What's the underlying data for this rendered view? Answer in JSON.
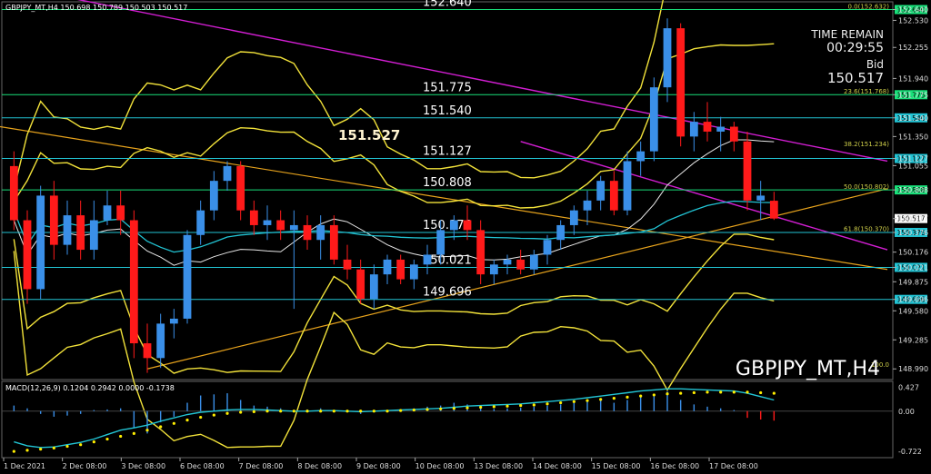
{
  "header": {
    "title": "GBPJPY_MT,H4  150.698 150.789 150.503 150.517"
  },
  "info": {
    "time_remain_label": "TIME REMAIN",
    "time_remain_value": "00:29:55",
    "bid_label": "Bid",
    "bid_value": "150.517",
    "highlight_price": "151.527",
    "symbol_watermark": "GBPJPY_MT,H4"
  },
  "colors": {
    "background": "#000000",
    "bull": "#3a8fe8",
    "bear": "#ff1a1a",
    "level_line": "#19e07a",
    "cyan_line": "#22c4d4",
    "bollinger": "#f2e23a",
    "magenta": "#d21ed2",
    "orange": "#e6a21c",
    "macd_hist": "#3a8fe8",
    "macd_signal": "#ffee00",
    "macd_line": "#22c4d4",
    "price_tag": "#1b5fd6"
  },
  "chart_data": {
    "type": "candlestick",
    "symbol": "GBPJPY_MT",
    "timeframe": "H4",
    "ylim": [
      148.9,
      152.7
    ],
    "y_ticks": [
      "152.640",
      "152.530",
      "152.255",
      "151.940",
      "151.775",
      "151.540",
      "151.350",
      "151.127",
      "151.055",
      "150.808",
      "150.517",
      "150.376",
      "150.176",
      "150.021",
      "149.875",
      "149.696",
      "149.580",
      "149.285",
      "148.990"
    ],
    "x_ticks": [
      "1 Dec 2021",
      "2 Dec 08:00",
      "3 Dec 08:00",
      "6 Dec 08:00",
      "7 Dec 08:00",
      "8 Dec 08:00",
      "9 Dec 08:00",
      "10 Dec 08:00",
      "13 Dec 08:00",
      "14 Dec 08:00",
      "15 Dec 08:00",
      "16 Dec 08:00",
      "17 Dec 08:00"
    ],
    "levels": [
      {
        "price": 152.64,
        "label": "152.640",
        "color": "green"
      },
      {
        "price": 151.775,
        "label": "151.775",
        "color": "green"
      },
      {
        "price": 151.54,
        "label": "151.540",
        "color": "cyan"
      },
      {
        "price": 151.127,
        "label": "151.127",
        "color": "cyan"
      },
      {
        "price": 150.808,
        "label": "150.808",
        "color": "green"
      },
      {
        "price": 150.376,
        "label": "150.376",
        "color": "cyan"
      },
      {
        "price": 150.021,
        "label": "150.021",
        "color": "cyan"
      },
      {
        "price": 149.696,
        "label": "149.696",
        "color": "cyan"
      }
    ],
    "fib_labels": [
      {
        "price": 152.632,
        "text": "0.0(152.632)"
      },
      {
        "price": 151.768,
        "text": "23.6(151.768)"
      },
      {
        "price": 151.234,
        "text": "38.2(151.234)"
      },
      {
        "price": 150.802,
        "text": "50.0(150.802)"
      },
      {
        "price": 150.37,
        "text": "61.8(150.370)"
      },
      {
        "price": 148.99,
        "text": "100.0"
      }
    ],
    "current_price": {
      "price": 150.517,
      "label": "150.517"
    },
    "candles": [
      {
        "o": 151.05,
        "h": 151.2,
        "l": 150.4,
        "c": 150.5
      },
      {
        "o": 150.5,
        "h": 150.6,
        "l": 149.65,
        "c": 149.8
      },
      {
        "o": 149.8,
        "h": 150.85,
        "l": 149.7,
        "c": 150.75
      },
      {
        "o": 150.75,
        "h": 150.9,
        "l": 150.1,
        "c": 150.25
      },
      {
        "o": 150.25,
        "h": 150.7,
        "l": 150.15,
        "c": 150.55
      },
      {
        "o": 150.55,
        "h": 150.7,
        "l": 150.1,
        "c": 150.2
      },
      {
        "o": 150.2,
        "h": 150.7,
        "l": 150.1,
        "c": 150.5
      },
      {
        "o": 150.5,
        "h": 150.8,
        "l": 150.45,
        "c": 150.65
      },
      {
        "o": 150.65,
        "h": 150.8,
        "l": 150.35,
        "c": 150.5
      },
      {
        "o": 150.5,
        "h": 150.6,
        "l": 149.1,
        "c": 149.25
      },
      {
        "o": 149.25,
        "h": 149.45,
        "l": 148.95,
        "c": 149.1
      },
      {
        "o": 149.1,
        "h": 149.55,
        "l": 149.0,
        "c": 149.45
      },
      {
        "o": 149.45,
        "h": 149.6,
        "l": 149.3,
        "c": 149.5
      },
      {
        "o": 149.5,
        "h": 150.4,
        "l": 149.45,
        "c": 150.35
      },
      {
        "o": 150.35,
        "h": 150.7,
        "l": 150.25,
        "c": 150.6
      },
      {
        "o": 150.6,
        "h": 151.0,
        "l": 150.5,
        "c": 150.9
      },
      {
        "o": 150.9,
        "h": 151.1,
        "l": 150.8,
        "c": 151.05
      },
      {
        "o": 151.05,
        "h": 151.1,
        "l": 150.5,
        "c": 150.6
      },
      {
        "o": 150.6,
        "h": 150.7,
        "l": 150.35,
        "c": 150.45
      },
      {
        "o": 150.45,
        "h": 150.65,
        "l": 150.3,
        "c": 150.5
      },
      {
        "o": 150.5,
        "h": 150.6,
        "l": 150.3,
        "c": 150.4
      },
      {
        "o": 150.4,
        "h": 150.6,
        "l": 149.6,
        "c": 150.45
      },
      {
        "o": 150.45,
        "h": 150.55,
        "l": 150.2,
        "c": 150.3
      },
      {
        "o": 150.3,
        "h": 150.55,
        "l": 150.1,
        "c": 150.45
      },
      {
        "o": 150.45,
        "h": 150.55,
        "l": 150.05,
        "c": 150.1
      },
      {
        "o": 150.1,
        "h": 150.25,
        "l": 149.9,
        "c": 150.0
      },
      {
        "o": 150.0,
        "h": 150.1,
        "l": 149.65,
        "c": 149.7
      },
      {
        "o": 149.7,
        "h": 150.05,
        "l": 149.6,
        "c": 149.95
      },
      {
        "o": 149.95,
        "h": 150.15,
        "l": 149.85,
        "c": 150.1
      },
      {
        "o": 150.1,
        "h": 150.15,
        "l": 149.85,
        "c": 149.9
      },
      {
        "o": 149.9,
        "h": 150.1,
        "l": 149.8,
        "c": 150.05
      },
      {
        "o": 150.05,
        "h": 150.25,
        "l": 149.95,
        "c": 150.15
      },
      {
        "o": 150.15,
        "h": 150.5,
        "l": 150.05,
        "c": 150.4
      },
      {
        "o": 150.4,
        "h": 150.55,
        "l": 150.3,
        "c": 150.5
      },
      {
        "o": 150.5,
        "h": 150.65,
        "l": 150.3,
        "c": 150.4
      },
      {
        "o": 150.4,
        "h": 150.5,
        "l": 149.85,
        "c": 149.95
      },
      {
        "o": 149.95,
        "h": 150.1,
        "l": 149.85,
        "c": 150.05
      },
      {
        "o": 150.05,
        "h": 150.15,
        "l": 149.95,
        "c": 150.1
      },
      {
        "o": 150.1,
        "h": 150.2,
        "l": 149.95,
        "c": 150.0
      },
      {
        "o": 150.0,
        "h": 150.2,
        "l": 149.95,
        "c": 150.15
      },
      {
        "o": 150.15,
        "h": 150.35,
        "l": 150.05,
        "c": 150.3
      },
      {
        "o": 150.3,
        "h": 150.5,
        "l": 150.2,
        "c": 150.45
      },
      {
        "o": 150.45,
        "h": 150.65,
        "l": 150.35,
        "c": 150.6
      },
      {
        "o": 150.6,
        "h": 150.8,
        "l": 150.45,
        "c": 150.7
      },
      {
        "o": 150.7,
        "h": 150.95,
        "l": 150.6,
        "c": 150.9
      },
      {
        "o": 150.9,
        "h": 151.0,
        "l": 150.55,
        "c": 150.6
      },
      {
        "o": 150.6,
        "h": 151.2,
        "l": 150.55,
        "c": 151.1
      },
      {
        "o": 151.1,
        "h": 151.3,
        "l": 150.95,
        "c": 151.2
      },
      {
        "o": 151.2,
        "h": 151.95,
        "l": 151.1,
        "c": 151.85
      },
      {
        "o": 151.85,
        "h": 152.55,
        "l": 151.7,
        "c": 152.45
      },
      {
        "o": 152.45,
        "h": 152.5,
        "l": 151.25,
        "c": 151.35
      },
      {
        "o": 151.35,
        "h": 151.6,
        "l": 151.2,
        "c": 151.5
      },
      {
        "o": 151.5,
        "h": 151.7,
        "l": 151.3,
        "c": 151.4
      },
      {
        "o": 151.4,
        "h": 151.55,
        "l": 151.2,
        "c": 151.45
      },
      {
        "o": 151.45,
        "h": 151.5,
        "l": 151.2,
        "c": 151.3
      },
      {
        "o": 151.3,
        "h": 151.4,
        "l": 150.6,
        "c": 150.7
      },
      {
        "o": 150.7,
        "h": 150.9,
        "l": 150.5,
        "c": 150.75
      },
      {
        "o": 150.698,
        "h": 150.789,
        "l": 150.503,
        "c": 150.517
      }
    ],
    "macd": {
      "label": "MACD(12,26,9) 0.1204 0.2942 0.0000 -0.1738",
      "ylim": [
        -0.8,
        0.5
      ],
      "y_ticks": [
        "0.427",
        "0.00",
        "-0.722"
      ],
      "histogram": [
        0.1,
        0.05,
        -0.05,
        -0.1,
        -0.08,
        -0.05,
        0.02,
        0.03,
        0.05,
        -0.3,
        -0.4,
        -0.2,
        -0.1,
        0.15,
        0.28,
        0.3,
        0.32,
        0.2,
        0.1,
        0.08,
        0.05,
        0.0,
        0.03,
        0.05,
        0.02,
        -0.02,
        -0.05,
        0.0,
        0.02,
        0.03,
        0.05,
        0.08,
        0.1,
        0.15,
        0.12,
        0.05,
        0.04,
        0.05,
        0.06,
        0.08,
        0.1,
        0.12,
        0.15,
        0.18,
        0.2,
        0.15,
        0.2,
        0.25,
        0.3,
        0.35,
        0.2,
        0.12,
        0.08,
        0.05,
        0.02,
        -0.12,
        -0.15,
        -0.17
      ],
      "macd_line": [
        -0.55,
        -0.62,
        -0.65,
        -0.64,
        -0.6,
        -0.56,
        -0.5,
        -0.42,
        -0.34,
        -0.3,
        -0.25,
        -0.18,
        -0.12,
        -0.06,
        -0.02,
        0.0,
        0.02,
        0.03,
        0.03,
        0.02,
        0.01,
        0.0,
        0.0,
        0.01,
        0.01,
        0.0,
        -0.01,
        0.0,
        0.01,
        0.02,
        0.03,
        0.04,
        0.05,
        0.07,
        0.09,
        0.1,
        0.11,
        0.12,
        0.13,
        0.15,
        0.17,
        0.19,
        0.21,
        0.24,
        0.27,
        0.3,
        0.33,
        0.36,
        0.38,
        0.4,
        0.4,
        0.39,
        0.38,
        0.37,
        0.36,
        0.32,
        0.26,
        0.2
      ],
      "signal_line": [
        -0.72,
        -0.7,
        -0.68,
        -0.66,
        -0.63,
        -0.6,
        -0.55,
        -0.5,
        -0.45,
        -0.4,
        -0.34,
        -0.28,
        -0.22,
        -0.16,
        -0.11,
        -0.07,
        -0.04,
        -0.02,
        -0.01,
        0.0,
        0.0,
        0.0,
        0.0,
        0.0,
        0.0,
        0.0,
        0.0,
        0.0,
        0.0,
        0.01,
        0.02,
        0.03,
        0.04,
        0.05,
        0.06,
        0.07,
        0.08,
        0.09,
        0.1,
        0.11,
        0.13,
        0.15,
        0.17,
        0.19,
        0.21,
        0.23,
        0.25,
        0.27,
        0.29,
        0.31,
        0.32,
        0.33,
        0.34,
        0.34,
        0.34,
        0.34,
        0.33,
        0.32
      ]
    }
  }
}
